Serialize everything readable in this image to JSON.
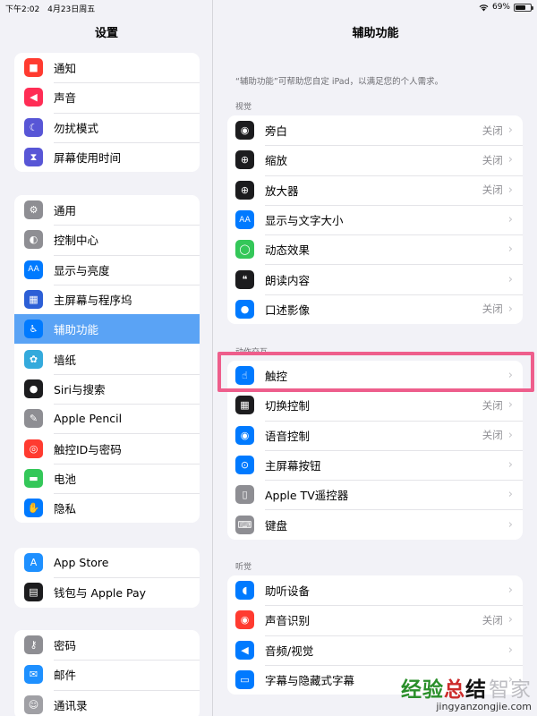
{
  "status_bar": {
    "time": "下午2:02",
    "date": "4月23日周五",
    "battery": "69%",
    "battery_level": 0.69,
    "wifi_icon": "wifi-icon"
  },
  "sidebar": {
    "title": "设置",
    "groups": [
      [
        {
          "label": "通知",
          "icon": "notification-icon",
          "color": "#ff3b30"
        },
        {
          "label": "声音",
          "icon": "speaker-icon",
          "color": "#ff2d55"
        },
        {
          "label": "勿扰模式",
          "icon": "moon-icon",
          "color": "#5856d6"
        },
        {
          "label": "屏幕使用时间",
          "icon": "hourglass-icon",
          "color": "#5856d6"
        }
      ],
      [
        {
          "label": "通用",
          "icon": "gear-icon",
          "color": "#8e8e93"
        },
        {
          "label": "控制中心",
          "icon": "toggles-icon",
          "color": "#8e8e93"
        },
        {
          "label": "显示与亮度",
          "icon": "text-size-icon",
          "color": "#007aff"
        },
        {
          "label": "主屏幕与程序坞",
          "icon": "grid-icon",
          "color": "#2c5fd6"
        },
        {
          "label": "辅助功能",
          "icon": "accessibility-icon",
          "color": "#007aff",
          "selected": true
        },
        {
          "label": "墙纸",
          "icon": "flower-icon",
          "color": "#34aadc"
        },
        {
          "label": "Siri与搜索",
          "icon": "siri-icon",
          "color": "#1c1c1e"
        },
        {
          "label": "Apple Pencil",
          "icon": "pencil-icon",
          "color": "#8e8e93"
        },
        {
          "label": "触控ID与密码",
          "icon": "fingerprint-icon",
          "color": "#ff3b30"
        },
        {
          "label": "电池",
          "icon": "battery-icon",
          "color": "#34c759"
        },
        {
          "label": "隐私",
          "icon": "hand-icon",
          "color": "#007aff"
        }
      ],
      [
        {
          "label": "App Store",
          "icon": "app-store-icon",
          "color": "#1e90ff"
        },
        {
          "label": "钱包与 Apple Pay",
          "icon": "wallet-icon",
          "color": "#1c1c1e"
        }
      ],
      [
        {
          "label": "密码",
          "icon": "key-icon",
          "color": "#8e8e93"
        },
        {
          "label": "邮件",
          "icon": "mail-icon",
          "color": "#1e90ff"
        },
        {
          "label": "通讯录",
          "icon": "contacts-icon",
          "color": "#a0a0a5"
        }
      ]
    ]
  },
  "main": {
    "title": "辅助功能",
    "description": "“辅助功能”可帮助您自定 iPad，以满足您的个人需求。",
    "sections": [
      {
        "header": "视觉",
        "items": [
          {
            "label": "旁白",
            "value": "关闭",
            "icon": "voiceover-icon",
            "color": "#1c1c1e"
          },
          {
            "label": "缩放",
            "value": "关闭",
            "icon": "zoom-icon",
            "color": "#1c1c1e"
          },
          {
            "label": "放大器",
            "value": "关闭",
            "icon": "magnifier-icon",
            "color": "#1c1c1e"
          },
          {
            "label": "显示与文字大小",
            "value": "",
            "icon": "text-size-icon",
            "color": "#007aff"
          },
          {
            "label": "动态效果",
            "value": "",
            "icon": "motion-icon",
            "color": "#34c759"
          },
          {
            "label": "朗读内容",
            "value": "",
            "icon": "speech-bubble-icon",
            "color": "#1c1c1e"
          },
          {
            "label": "口述影像",
            "value": "关闭",
            "icon": "audio-description-icon",
            "color": "#007aff"
          }
        ]
      },
      {
        "header": "动作交互",
        "items": [
          {
            "label": "触控",
            "value": "",
            "icon": "touch-hand-icon",
            "color": "#007aff"
          },
          {
            "label": "切换控制",
            "value": "关闭",
            "icon": "switch-grid-icon",
            "color": "#1c1c1e"
          },
          {
            "label": "语音控制",
            "value": "关闭",
            "icon": "voice-control-icon",
            "color": "#007aff"
          },
          {
            "label": "主屏幕按钮",
            "value": "",
            "icon": "home-button-icon",
            "color": "#007aff"
          },
          {
            "label": "Apple TV遥控器",
            "value": "",
            "icon": "remote-icon",
            "color": "#8e8e93"
          },
          {
            "label": "键盘",
            "value": "",
            "icon": "keyboard-icon",
            "color": "#8e8e93"
          }
        ]
      },
      {
        "header": "听觉",
        "items": [
          {
            "label": "助听设备",
            "value": "",
            "icon": "ear-icon",
            "color": "#007aff"
          },
          {
            "label": "声音识别",
            "value": "关闭",
            "icon": "sound-recognition-icon",
            "color": "#ff3b30"
          },
          {
            "label": "音频/视觉",
            "value": "",
            "icon": "audio-visual-icon",
            "color": "#007aff"
          },
          {
            "label": "字幕与隐藏式字幕",
            "value": "",
            "icon": "subtitles-icon",
            "color": "#007aff"
          }
        ]
      }
    ]
  },
  "watermark": {
    "main": "经验总结",
    "ghost": "智家",
    "url": "jingyanzongjie.com"
  }
}
